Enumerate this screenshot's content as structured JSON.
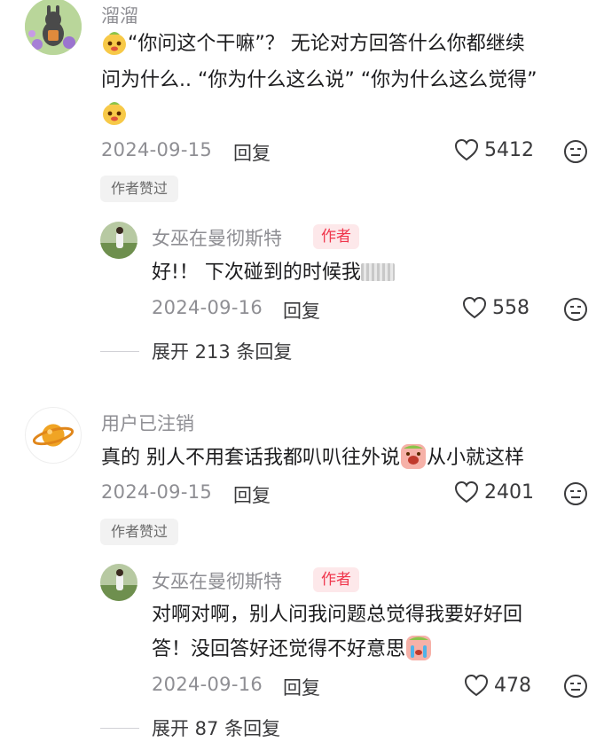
{
  "comments": [
    {
      "username": "溜溜",
      "text_line1_a": "“你问这个干嘛”？ 无论对方回答什么你都继续",
      "text_line2": "问为什么.. “你为什么这么说” “你为什么这么觉得”",
      "date": "2024-09-15",
      "reply_label": "回复",
      "likes": "5412",
      "author_liked": "作者赞过",
      "reply": {
        "username": "女巫在曼彻斯特",
        "author_tag": "作者",
        "text": "好!！ 下次碰到的时候我",
        "date": "2024-09-16",
        "reply_label": "回复",
        "likes": "558"
      },
      "expand_label": "展开 213 条回复"
    },
    {
      "username": "用户已注销",
      "text_a": "真的 别人不用套话我都叭叭往外说",
      "text_b": "从小就这样",
      "date": "2024-09-15",
      "reply_label": "回复",
      "likes": "2401",
      "author_liked": "作者赞过",
      "reply": {
        "username": "女巫在曼彻斯特",
        "author_tag": "作者",
        "text_line1": "对啊对啊，别人问我问题总觉得我要好好回",
        "text_line2": "答！没回答好还觉得不好意思",
        "date": "2024-09-16",
        "reply_label": "回复",
        "likes": "478"
      },
      "expand_label": "展开 87 条回复"
    }
  ],
  "icons": {
    "like": "heart-outline-icon",
    "dislike": "frown-face-icon"
  },
  "colors": {
    "author_tag_bg": "#fde8ea",
    "author_tag_text": "#f0364c",
    "meta_gray": "#8e8e93"
  }
}
